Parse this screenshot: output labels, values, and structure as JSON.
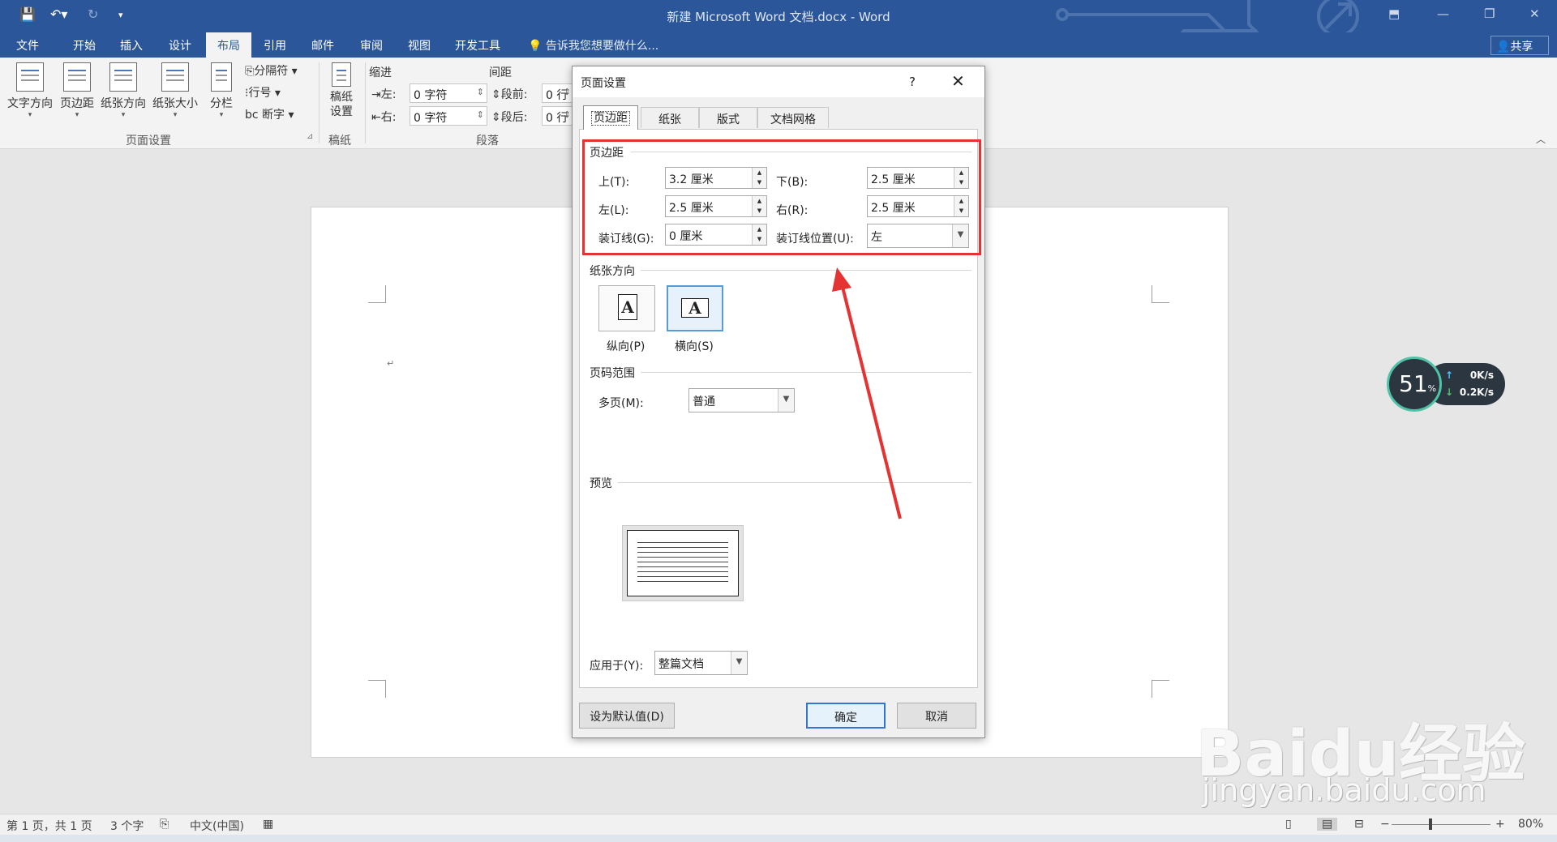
{
  "window": {
    "title": "新建 Microsoft Word 文档.docx - Word"
  },
  "menu": {
    "tabs": [
      "文件",
      "开始",
      "插入",
      "设计",
      "布局",
      "引用",
      "邮件",
      "审阅",
      "视图",
      "开发工具"
    ],
    "active": "布局",
    "tell_me": "告诉我您想要做什么...",
    "share": "共享"
  },
  "ribbon": {
    "page_setup": {
      "text_direction": "文字方向",
      "margins": "页边距",
      "orientation": "纸张方向",
      "size": "纸张大小",
      "columns": "分栏",
      "breaks": "分隔符",
      "line_numbers": "行号",
      "hyphenation": "断字",
      "group_label": "页面设置"
    },
    "manuscript": {
      "label": "稿纸\n设置",
      "group_label": "稿纸"
    },
    "paragraph": {
      "indent_header": "缩进",
      "spacing_header": "间距",
      "left_label": "左:",
      "left_value": "0 字符",
      "right_label": "右:",
      "right_value": "0 字符",
      "before_label": "段前:",
      "before_value": "0 行",
      "after_label": "段后:",
      "after_value": "0 行",
      "group_label": "段落"
    }
  },
  "dialog": {
    "title": "页面设置",
    "help": "?",
    "close": "✕",
    "tabs": [
      "页边距",
      "纸张",
      "版式",
      "文档网格"
    ],
    "active_tab": "页边距",
    "margins_section": "页边距",
    "top_label": "上(T):",
    "top_value": "3.2 厘米",
    "bottom_label": "下(B):",
    "bottom_value": "2.5 厘米",
    "left_label": "左(L):",
    "left_value": "2.5 厘米",
    "right_label": "右(R):",
    "right_value": "2.5 厘米",
    "gutter_label": "装订线(G):",
    "gutter_value": "0 厘米",
    "gutter_pos_label": "装订线位置(U):",
    "gutter_pos_value": "左",
    "orientation_section": "纸张方向",
    "portrait": "纵向(P)",
    "landscape": "横向(S)",
    "pages_section": "页码范围",
    "multiple_pages_label": "多页(M):",
    "multiple_pages_value": "普通",
    "preview_section": "预览",
    "apply_to_label": "应用于(Y):",
    "apply_to_value": "整篇文档",
    "set_default": "设为默认值(D)",
    "ok": "确定",
    "cancel": "取消"
  },
  "statusbar": {
    "page": "第 1 页，共 1 页",
    "words": "3 个字",
    "language": "中文(中国)",
    "zoom": "80%"
  },
  "netmon": {
    "percent": "51",
    "percent_unit": "%",
    "up": "0K/s",
    "down": "0.2K/s"
  },
  "watermark": {
    "line1": "Baidu经验",
    "line2": "jingyan.baidu.com"
  },
  "colors": {
    "accent": "#2b579a",
    "highlight": "#e53333"
  }
}
